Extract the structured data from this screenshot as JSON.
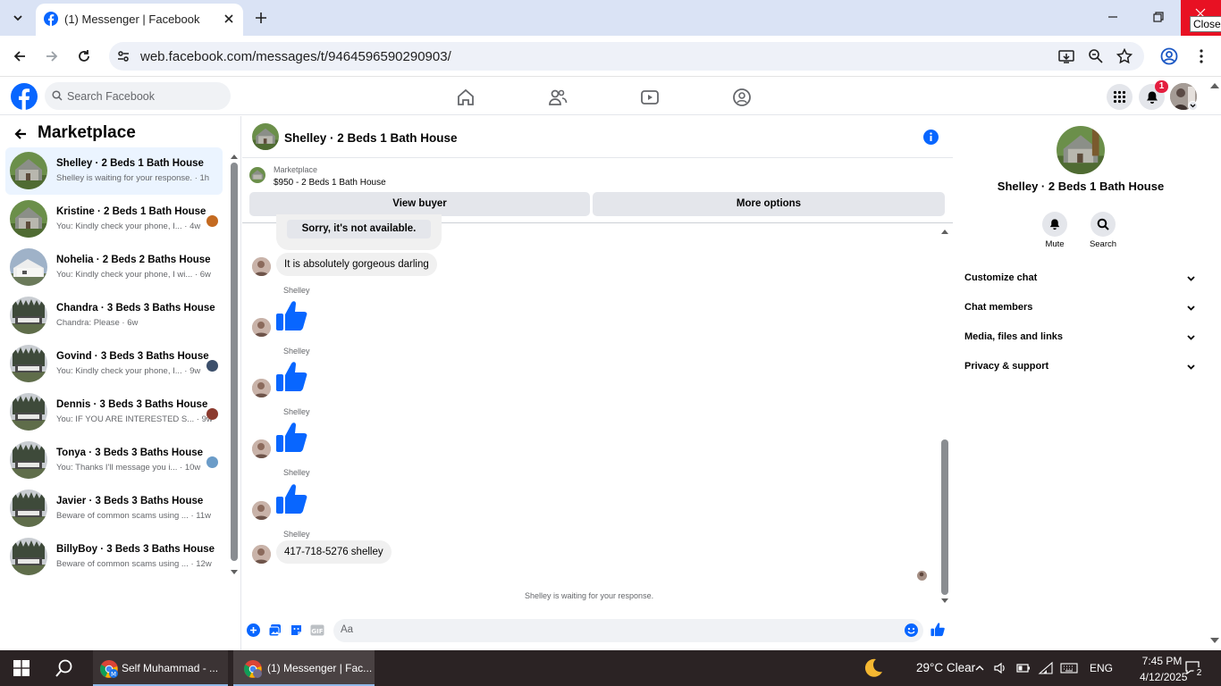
{
  "browser": {
    "tab_title": "(1) Messenger | Facebook",
    "url": "web.facebook.com/messages/t/9464596590290903/",
    "close_tooltip": "Close"
  },
  "fb": {
    "search_placeholder": "Search Facebook",
    "notification_count": "1"
  },
  "left": {
    "title": "Marketplace",
    "conversations": [
      {
        "name": "Shelley · 2 Beds 1 Bath House",
        "preview": "Shelley is waiting for your response. · 1h"
      },
      {
        "name": "Kristine · 2 Beds 1 Bath House",
        "preview": "You: Kindly check your phone, I... · 4w"
      },
      {
        "name": "Nohelia · 2 Beds 2 Baths House",
        "preview": "You: Kindly check your phone, I wi... · 6w"
      },
      {
        "name": "Chandra · 3 Beds 3 Baths House",
        "preview": "Chandra: Please · 6w"
      },
      {
        "name": "Govind · 3 Beds 3 Baths House",
        "preview": "You: Kindly check your phone, I... · 9w"
      },
      {
        "name": "Dennis · 3 Beds 3 Baths House",
        "preview": "You: IF YOU ARE INTERESTED S... · 9w"
      },
      {
        "name": "Tonya · 3 Beds 3 Baths House",
        "preview": "You: Thanks I'll message you i... · 10w"
      },
      {
        "name": "Javier · 3 Beds 3 Baths House",
        "preview": "Beware of common scams using ... · 11w"
      },
      {
        "name": "BillyBoy · 3 Beds 3 Baths House",
        "preview": "Beware of common scams using ... · 12w"
      }
    ]
  },
  "chat": {
    "title": "Shelley · 2 Beds 1 Bath House",
    "marketplace_label": "Marketplace",
    "listing": "$950 - 2 Beds 1 Bath House",
    "view_buyer": "View buyer",
    "more_options": "More options",
    "messages": [
      {
        "text": "Sorry, it's not available."
      },
      {
        "text": "It is absolutely gorgeous darling"
      },
      {
        "sender": "Shelley"
      },
      {
        "sender": "Shelley"
      },
      {
        "sender": "Shelley"
      },
      {
        "sender": "Shelley"
      },
      {
        "sender": "Shelley",
        "text": "417-718-5276 shelley"
      }
    ],
    "waiting_note": "Shelley is waiting for your response.",
    "composer_placeholder": "Aa"
  },
  "right": {
    "name": "Shelley · 2 Beds 1 Bath House",
    "mute_label": "Mute",
    "search_label": "Search",
    "sections": [
      "Customize chat",
      "Chat members",
      "Media, files and links",
      "Privacy & support"
    ]
  },
  "taskbar": {
    "app1": "Self Muhammad - ...",
    "app2": "(1) Messenger | Fac...",
    "weather": "29°C  Clear",
    "lang": "ENG",
    "time": "7:45 PM",
    "date": "4/12/2025",
    "notif_count": "2"
  },
  "colors": {
    "fb_blue": "#0866ff",
    "close_red": "#e81123",
    "taskbar": "#2b2324"
  }
}
